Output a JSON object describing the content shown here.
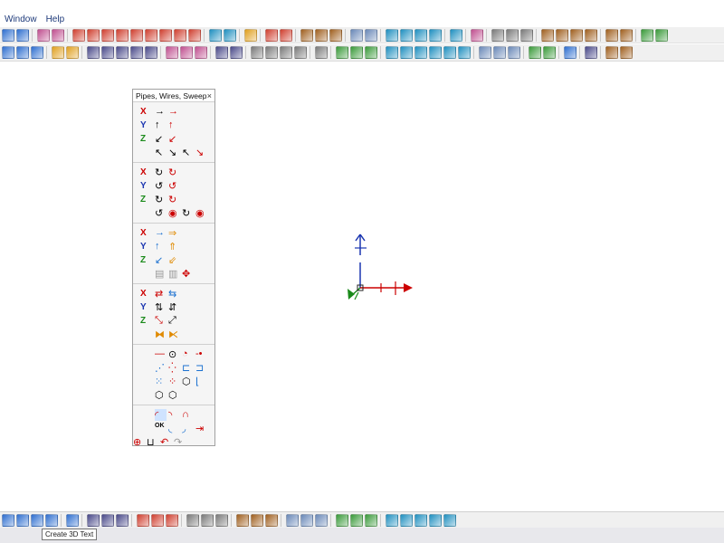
{
  "menu": {
    "window": "Window",
    "help": "Help"
  },
  "panel": {
    "title": "Pipes, Wires, Sweep",
    "close_glyph": "×",
    "axis_x": "X",
    "axis_y": "Y",
    "axis_z": "Z"
  },
  "tooltip": {
    "text": "Create 3D Text"
  },
  "colors": {
    "axis_x": "#cc0000",
    "axis_y": "#1a35b0",
    "axis_z": "#1a8a1a"
  }
}
